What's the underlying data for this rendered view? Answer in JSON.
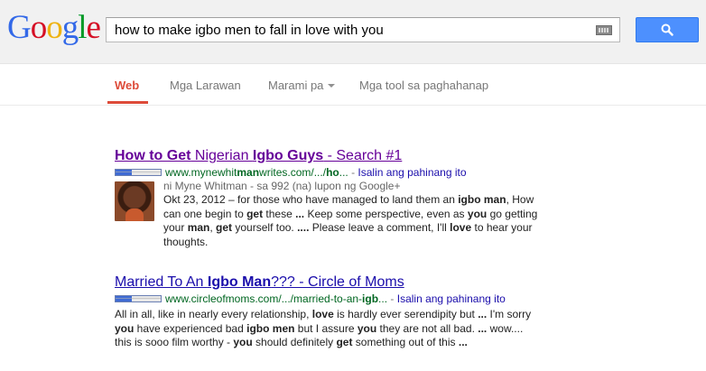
{
  "logo": "Google",
  "search": {
    "query": "how to make igbo men to fall in love with you"
  },
  "tabs": {
    "web": "Web",
    "images": "Mga Larawan",
    "more": "Marami pa",
    "tools": "Mga tool sa paghahanap"
  },
  "results": [
    {
      "title_parts": [
        "How to Get",
        " Nigerian ",
        "Igbo Guys",
        " - Search #1"
      ],
      "url_parts": [
        "www.mynewhit",
        "man",
        "writes.com/.../",
        "ho",
        "..."
      ],
      "translate": "Isalin ang pahinang ito",
      "author": "ni Myne Whitman - sa 992 (na) lupon ng Google+",
      "snippet_lines": [
        [
          "Okt 23, 2012 – for those who have managed to land them an ",
          "igbo man",
          ", How"
        ],
        [
          "can one begin to ",
          "get",
          " these ",
          "...",
          " Keep some perspective, even as ",
          "you",
          " go getting"
        ],
        [
          "your ",
          "man",
          ", ",
          "get",
          " yourself too. ",
          "....",
          " Please leave a comment, I'll ",
          "love",
          " to hear your"
        ],
        [
          "thoughts."
        ]
      ]
    },
    {
      "title_parts": [
        "Married To An ",
        "Igbo Man",
        "??? - Circle of Moms"
      ],
      "url_parts": [
        "www.circleofmoms.com/.../married-to-an-",
        "igb",
        "..."
      ],
      "translate": "Isalin ang pahinang ito",
      "snippet_lines": [
        [
          "All in all, like in nearly every relationship, ",
          "love",
          " is hardly ever serendipity but ",
          "...",
          " I'm sorry"
        ],
        [
          "you",
          " have experienced bad ",
          "igbo men",
          " but I assure ",
          "you",
          " they are not all bad. ",
          "...",
          " wow...."
        ],
        [
          "this is sooo film worthy - ",
          "you",
          " should definitely ",
          "get",
          " something out of this ",
          "..."
        ]
      ]
    }
  ],
  "colors": {
    "logo": [
      "#3369e8",
      "#d50f25",
      "#eeb211",
      "#3369e8",
      "#009925",
      "#d50f25"
    ],
    "active_tab": "#dd4b39",
    "search_button": "#4d90fe"
  },
  "icons": {
    "keyboard": "keyboard-icon",
    "search": "magnifier-icon"
  }
}
